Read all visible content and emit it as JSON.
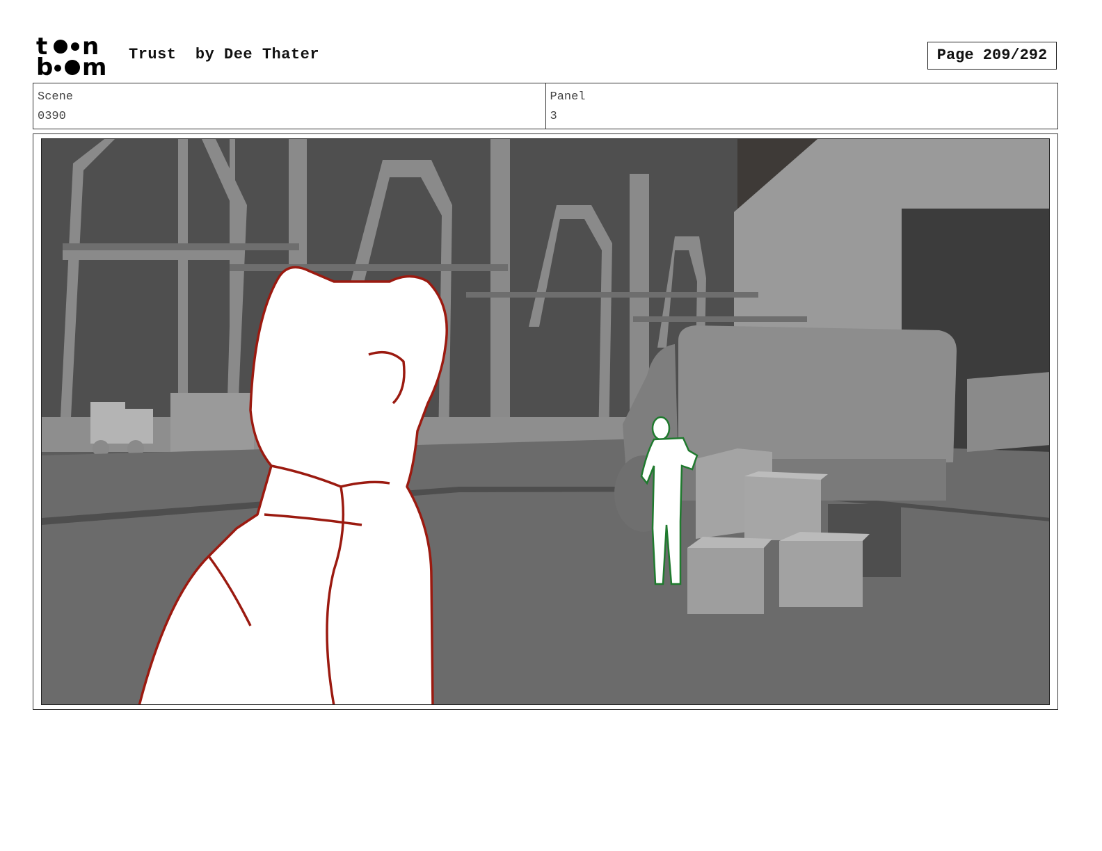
{
  "header": {
    "logo_text": "toon boom",
    "title": "Trust  by Dee Thater",
    "page": "Page 209/292"
  },
  "info": {
    "scene_label": "Scene",
    "scene_value": "0390",
    "panel_label": "Panel",
    "panel_value": "3"
  },
  "colors": {
    "foreground_outline": "#9b1a10",
    "background_character_outline": "#1f7a2e",
    "set_gray": "#6a6a6a"
  }
}
